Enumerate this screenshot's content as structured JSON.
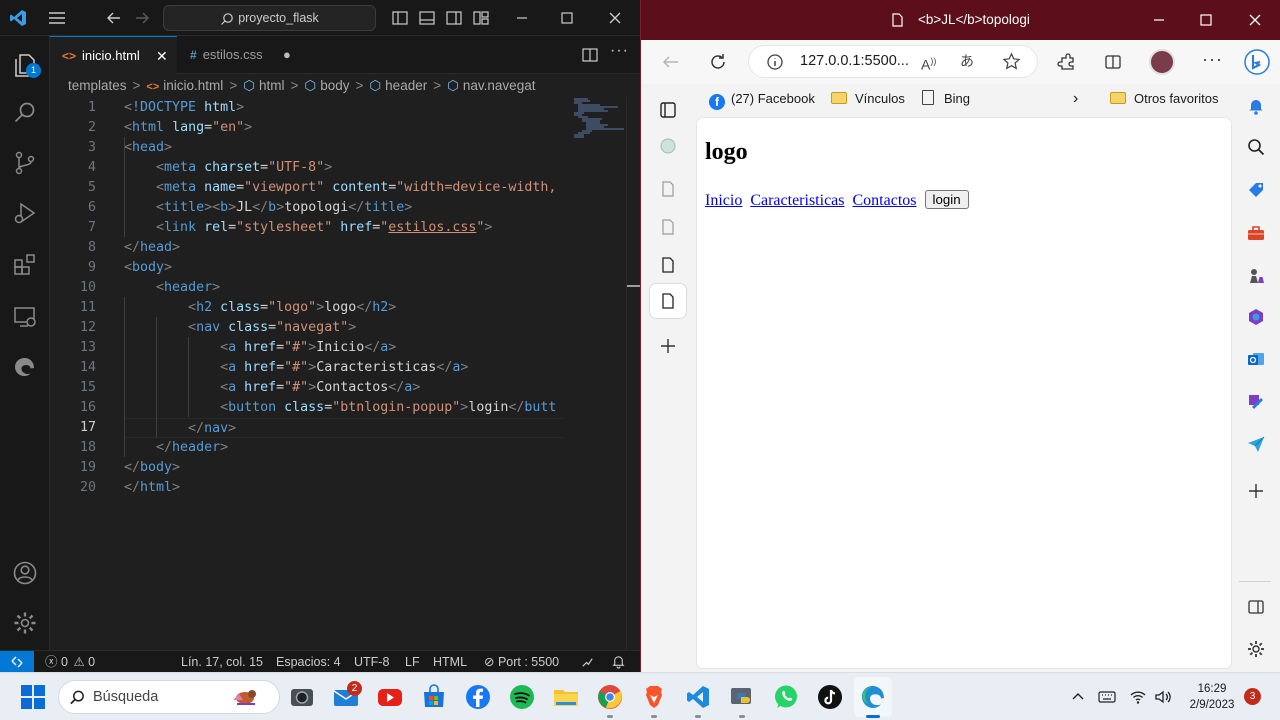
{
  "vscode": {
    "command_center": "proyecto_flask",
    "scm_badge": "1",
    "tabs": [
      {
        "icon": "html-file-icon",
        "label": "inicio.html",
        "close": "✕",
        "active": true
      },
      {
        "icon": "css-file-icon",
        "label": "estilos.css",
        "modified_dot": "●",
        "lang": "#"
      }
    ],
    "breadcrumb": [
      "templates",
      "inicio.html",
      "html",
      "body",
      "header",
      "nav.navegat"
    ],
    "line_numbers": [
      "1",
      "2",
      "3",
      "4",
      "5",
      "6",
      "7",
      "8",
      "9",
      "10",
      "11",
      "12",
      "13",
      "14",
      "15",
      "16",
      "17",
      "18",
      "19",
      "20"
    ],
    "current_line": "17",
    "code": [
      "<!DOCTYPE html>",
      "<html lang=\"en\">",
      "<head>",
      "    <meta charset=\"UTF-8\">",
      "    <meta name=\"viewport\" content=\"width=device-width,",
      "    <title><b>JL</b>topologi</title>",
      "    <link rel=\"stylesheet\" href=\"estilos.css\">",
      "</head>",
      "<body>",
      "    <header>",
      "        <h2 class=\"logo\">logo</h2>",
      "        <nav class=\"navegat\">",
      "            <a href=\"#\">Inicio</a>",
      "            <a href=\"#\">Caracteristicas</a>",
      "            <a href=\"#\">Contactos</a>",
      "            <button class=\"btnlogin-popup\">login</butt",
      "        </nav>",
      "    </header>",
      "</body>",
      "</html>"
    ],
    "status": {
      "errors": "0",
      "warnings": "0",
      "position": "Lín. 17, col. 15",
      "spaces": "Espacios: 4",
      "encoding": "UTF-8",
      "eol": "LF",
      "language": "HTML",
      "port": "Port : 5500"
    }
  },
  "edge": {
    "window_title": "<b>JL</b>topologi",
    "address": "127.0.0.1:5500...",
    "favorites": [
      {
        "icon": "facebook-icon",
        "label": "(27) Facebook"
      },
      {
        "icon": "folder-icon",
        "label": "Vínculos"
      },
      {
        "icon": "page-icon",
        "label": "Bing"
      },
      {
        "icon": "folder-icon",
        "label": "Otros favoritos"
      }
    ],
    "page": {
      "heading": "logo",
      "links": [
        "Inicio",
        "Caracteristicas",
        "Contactos"
      ],
      "button": "login"
    }
  },
  "taskbar": {
    "search_placeholder": "Búsqueda",
    "mail_badge": "2",
    "time": "16:29",
    "date": "2/9/2023",
    "notifications": "3"
  },
  "colors": {
    "vscode_bg": "#1f1f1f",
    "accent": "#0078d4",
    "edge_titlebar": "#5c0f1a",
    "html_tag": "#569cd6",
    "attr": "#9cdcfe",
    "string": "#ce9178"
  }
}
